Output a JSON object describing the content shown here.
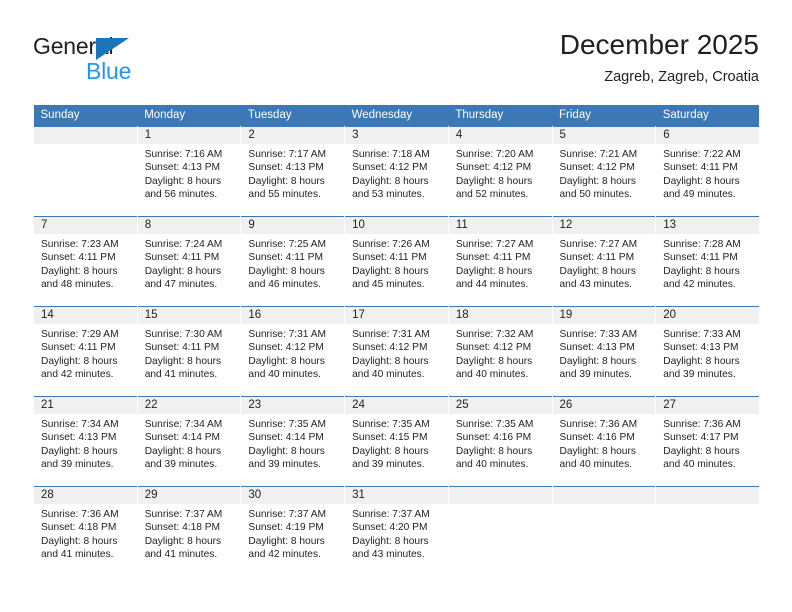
{
  "brand": {
    "name_top": "General",
    "name_bottom": "Blue",
    "triangle_icon": "triangle-icon",
    "accent_dark": "#231f20",
    "accent_blue": "#2196f3",
    "triangle_color": "#1b75bb"
  },
  "header": {
    "title": "December 2025",
    "subtitle": "Zagreb, Zagreb, Croatia"
  },
  "calendar": {
    "header_bg": "#3b78b5",
    "daynum_bg": "#f0f0f0",
    "weekdays": [
      "Sunday",
      "Monday",
      "Tuesday",
      "Wednesday",
      "Thursday",
      "Friday",
      "Saturday"
    ],
    "weeks": [
      [
        {
          "day": "",
          "empty": true,
          "sunrise": "",
          "sunset": "",
          "daylight_line1": "",
          "daylight_line2": ""
        },
        {
          "day": "1",
          "sunrise": "Sunrise: 7:16 AM",
          "sunset": "Sunset: 4:13 PM",
          "daylight_line1": "Daylight: 8 hours",
          "daylight_line2": "and 56 minutes."
        },
        {
          "day": "2",
          "sunrise": "Sunrise: 7:17 AM",
          "sunset": "Sunset: 4:13 PM",
          "daylight_line1": "Daylight: 8 hours",
          "daylight_line2": "and 55 minutes."
        },
        {
          "day": "3",
          "sunrise": "Sunrise: 7:18 AM",
          "sunset": "Sunset: 4:12 PM",
          "daylight_line1": "Daylight: 8 hours",
          "daylight_line2": "and 53 minutes."
        },
        {
          "day": "4",
          "sunrise": "Sunrise: 7:20 AM",
          "sunset": "Sunset: 4:12 PM",
          "daylight_line1": "Daylight: 8 hours",
          "daylight_line2": "and 52 minutes."
        },
        {
          "day": "5",
          "sunrise": "Sunrise: 7:21 AM",
          "sunset": "Sunset: 4:12 PM",
          "daylight_line1": "Daylight: 8 hours",
          "daylight_line2": "and 50 minutes."
        },
        {
          "day": "6",
          "sunrise": "Sunrise: 7:22 AM",
          "sunset": "Sunset: 4:11 PM",
          "daylight_line1": "Daylight: 8 hours",
          "daylight_line2": "and 49 minutes."
        }
      ],
      [
        {
          "day": "7",
          "sunrise": "Sunrise: 7:23 AM",
          "sunset": "Sunset: 4:11 PM",
          "daylight_line1": "Daylight: 8 hours",
          "daylight_line2": "and 48 minutes."
        },
        {
          "day": "8",
          "sunrise": "Sunrise: 7:24 AM",
          "sunset": "Sunset: 4:11 PM",
          "daylight_line1": "Daylight: 8 hours",
          "daylight_line2": "and 47 minutes."
        },
        {
          "day": "9",
          "sunrise": "Sunrise: 7:25 AM",
          "sunset": "Sunset: 4:11 PM",
          "daylight_line1": "Daylight: 8 hours",
          "daylight_line2": "and 46 minutes."
        },
        {
          "day": "10",
          "sunrise": "Sunrise: 7:26 AM",
          "sunset": "Sunset: 4:11 PM",
          "daylight_line1": "Daylight: 8 hours",
          "daylight_line2": "and 45 minutes."
        },
        {
          "day": "11",
          "sunrise": "Sunrise: 7:27 AM",
          "sunset": "Sunset: 4:11 PM",
          "daylight_line1": "Daylight: 8 hours",
          "daylight_line2": "and 44 minutes."
        },
        {
          "day": "12",
          "sunrise": "Sunrise: 7:27 AM",
          "sunset": "Sunset: 4:11 PM",
          "daylight_line1": "Daylight: 8 hours",
          "daylight_line2": "and 43 minutes."
        },
        {
          "day": "13",
          "sunrise": "Sunrise: 7:28 AM",
          "sunset": "Sunset: 4:11 PM",
          "daylight_line1": "Daylight: 8 hours",
          "daylight_line2": "and 42 minutes."
        }
      ],
      [
        {
          "day": "14",
          "sunrise": "Sunrise: 7:29 AM",
          "sunset": "Sunset: 4:11 PM",
          "daylight_line1": "Daylight: 8 hours",
          "daylight_line2": "and 42 minutes."
        },
        {
          "day": "15",
          "sunrise": "Sunrise: 7:30 AM",
          "sunset": "Sunset: 4:11 PM",
          "daylight_line1": "Daylight: 8 hours",
          "daylight_line2": "and 41 minutes."
        },
        {
          "day": "16",
          "sunrise": "Sunrise: 7:31 AM",
          "sunset": "Sunset: 4:12 PM",
          "daylight_line1": "Daylight: 8 hours",
          "daylight_line2": "and 40 minutes."
        },
        {
          "day": "17",
          "sunrise": "Sunrise: 7:31 AM",
          "sunset": "Sunset: 4:12 PM",
          "daylight_line1": "Daylight: 8 hours",
          "daylight_line2": "and 40 minutes."
        },
        {
          "day": "18",
          "sunrise": "Sunrise: 7:32 AM",
          "sunset": "Sunset: 4:12 PM",
          "daylight_line1": "Daylight: 8 hours",
          "daylight_line2": "and 40 minutes."
        },
        {
          "day": "19",
          "sunrise": "Sunrise: 7:33 AM",
          "sunset": "Sunset: 4:13 PM",
          "daylight_line1": "Daylight: 8 hours",
          "daylight_line2": "and 39 minutes."
        },
        {
          "day": "20",
          "sunrise": "Sunrise: 7:33 AM",
          "sunset": "Sunset: 4:13 PM",
          "daylight_line1": "Daylight: 8 hours",
          "daylight_line2": "and 39 minutes."
        }
      ],
      [
        {
          "day": "21",
          "sunrise": "Sunrise: 7:34 AM",
          "sunset": "Sunset: 4:13 PM",
          "daylight_line1": "Daylight: 8 hours",
          "daylight_line2": "and 39 minutes."
        },
        {
          "day": "22",
          "sunrise": "Sunrise: 7:34 AM",
          "sunset": "Sunset: 4:14 PM",
          "daylight_line1": "Daylight: 8 hours",
          "daylight_line2": "and 39 minutes."
        },
        {
          "day": "23",
          "sunrise": "Sunrise: 7:35 AM",
          "sunset": "Sunset: 4:14 PM",
          "daylight_line1": "Daylight: 8 hours",
          "daylight_line2": "and 39 minutes."
        },
        {
          "day": "24",
          "sunrise": "Sunrise: 7:35 AM",
          "sunset": "Sunset: 4:15 PM",
          "daylight_line1": "Daylight: 8 hours",
          "daylight_line2": "and 39 minutes."
        },
        {
          "day": "25",
          "sunrise": "Sunrise: 7:35 AM",
          "sunset": "Sunset: 4:16 PM",
          "daylight_line1": "Daylight: 8 hours",
          "daylight_line2": "and 40 minutes."
        },
        {
          "day": "26",
          "sunrise": "Sunrise: 7:36 AM",
          "sunset": "Sunset: 4:16 PM",
          "daylight_line1": "Daylight: 8 hours",
          "daylight_line2": "and 40 minutes."
        },
        {
          "day": "27",
          "sunrise": "Sunrise: 7:36 AM",
          "sunset": "Sunset: 4:17 PM",
          "daylight_line1": "Daylight: 8 hours",
          "daylight_line2": "and 40 minutes."
        }
      ],
      [
        {
          "day": "28",
          "sunrise": "Sunrise: 7:36 AM",
          "sunset": "Sunset: 4:18 PM",
          "daylight_line1": "Daylight: 8 hours",
          "daylight_line2": "and 41 minutes."
        },
        {
          "day": "29",
          "sunrise": "Sunrise: 7:37 AM",
          "sunset": "Sunset: 4:18 PM",
          "daylight_line1": "Daylight: 8 hours",
          "daylight_line2": "and 41 minutes."
        },
        {
          "day": "30",
          "sunrise": "Sunrise: 7:37 AM",
          "sunset": "Sunset: 4:19 PM",
          "daylight_line1": "Daylight: 8 hours",
          "daylight_line2": "and 42 minutes."
        },
        {
          "day": "31",
          "sunrise": "Sunrise: 7:37 AM",
          "sunset": "Sunset: 4:20 PM",
          "daylight_line1": "Daylight: 8 hours",
          "daylight_line2": "and 43 minutes."
        },
        {
          "day": "",
          "empty": true,
          "sunrise": "",
          "sunset": "",
          "daylight_line1": "",
          "daylight_line2": ""
        },
        {
          "day": "",
          "empty": true,
          "sunrise": "",
          "sunset": "",
          "daylight_line1": "",
          "daylight_line2": ""
        },
        {
          "day": "",
          "empty": true,
          "sunrise": "",
          "sunset": "",
          "daylight_line1": "",
          "daylight_line2": ""
        }
      ]
    ]
  }
}
